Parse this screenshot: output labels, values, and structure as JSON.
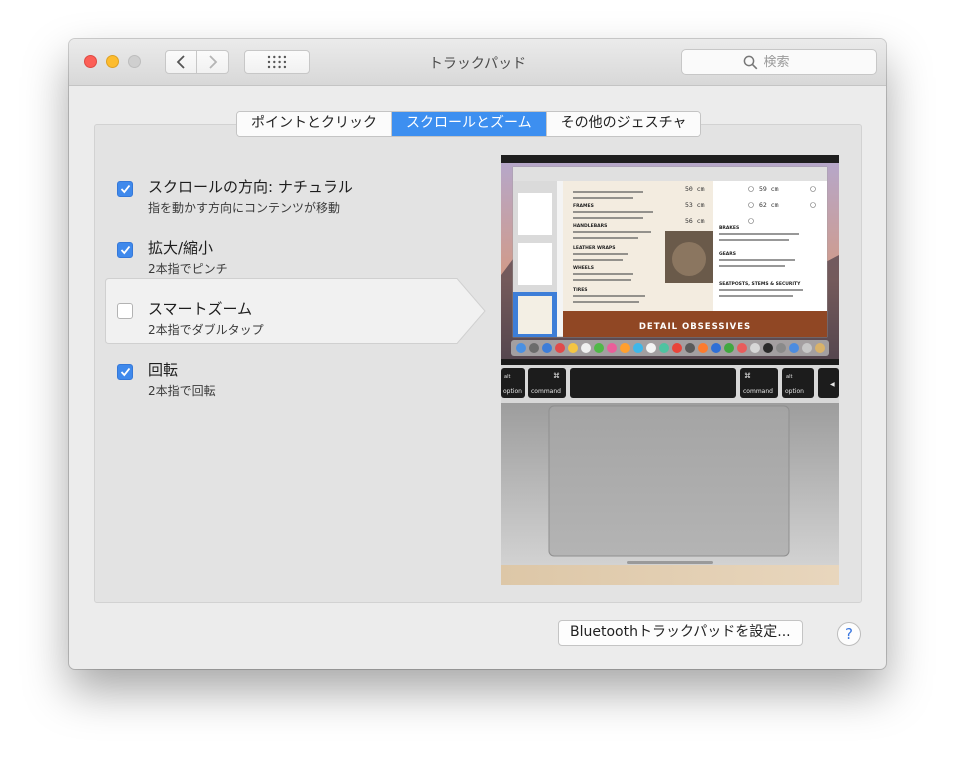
{
  "window": {
    "title": "トラックパッド"
  },
  "search": {
    "placeholder": "検索"
  },
  "tabs": [
    {
      "label": "ポイントとクリック",
      "active": false
    },
    {
      "label": "スクロールとズーム",
      "active": true
    },
    {
      "label": "その他のジェスチャ",
      "active": false
    }
  ],
  "options": [
    {
      "title": "スクロールの方向: ナチュラル",
      "subtitle": "指を動かす方向にコンテンツが移動",
      "checked": true
    },
    {
      "title": "拡大/縮小",
      "subtitle": "2本指でピンチ",
      "checked": true
    },
    {
      "title": "スマートズーム",
      "subtitle": "2本指でダブルタップ",
      "checked": false,
      "selected": true
    },
    {
      "title": "回転",
      "subtitle": "2本指で回転",
      "checked": true
    }
  ],
  "preview": {
    "banner": "DETAIL OBSESSIVES",
    "sizes": [
      "50 cm",
      "59 cm",
      "53 cm",
      "62 cm",
      "56 cm"
    ],
    "keys": {
      "alt": "alt",
      "option": "option",
      "cmd_symbol": "⌘",
      "command": "command"
    },
    "doc_headings": [
      "FRAMES",
      "HANDLEBARS",
      "LEATHER WRAPS",
      "WHEELS",
      "TIRES",
      "BRAKES",
      "GEARS",
      "SEATPOSTS, STEMS & SECURITY"
    ]
  },
  "footer": {
    "bluetooth_button": "Bluetoothトラックパッドを設定...",
    "help": "?"
  },
  "colors": {
    "accent": "#3d8ff0",
    "checkbox": "#3f89ec"
  }
}
